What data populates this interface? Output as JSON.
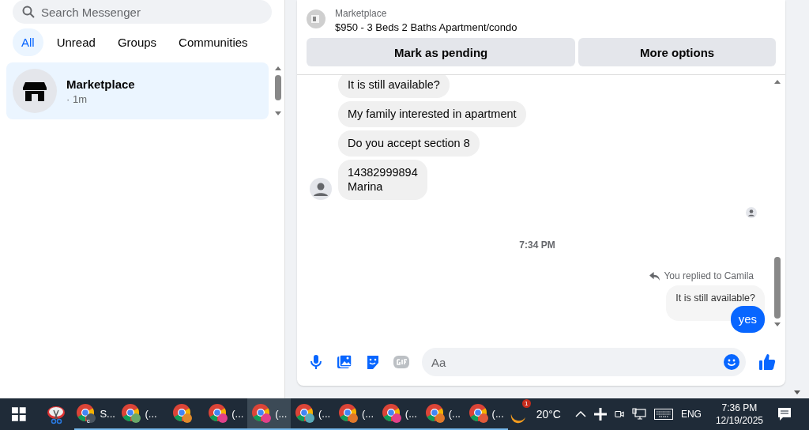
{
  "sidebar": {
    "search": {
      "placeholder": "Search Messenger"
    },
    "filters": [
      {
        "label": "All",
        "selected": true
      },
      {
        "label": "Unread",
        "selected": false
      },
      {
        "label": "Groups",
        "selected": false
      },
      {
        "label": "Communities",
        "selected": false
      }
    ],
    "conversations": [
      {
        "name": "Marketplace",
        "time": "· 1m",
        "selected": true
      }
    ]
  },
  "chat": {
    "listing": {
      "category": "Marketplace",
      "title": "$950 - 3 Beds 2 Baths Apartment/condo"
    },
    "actions": [
      "Mark as pending",
      "More options"
    ],
    "incoming": [
      "It is still available?",
      "My family  interested in apartment",
      "Do you accept section 8",
      "14382999894\nMarina"
    ],
    "timestamp": "7:34 PM",
    "reply": {
      "label": "You replied to Camila",
      "quoted": "It is still available?",
      "text": "yes"
    },
    "composer": {
      "placeholder": "Aa"
    }
  },
  "taskbar": {
    "apps": [
      {
        "label": "S...",
        "color": "#4a5560",
        "selected": false,
        "badge": "c"
      },
      {
        "label": "(...",
        "color": "#6aa86a",
        "selected": false
      },
      {
        "color": "#e08a2a",
        "selected": false
      },
      {
        "label": "(...",
        "color": "#e0408a",
        "selected": false
      },
      {
        "label": "(...",
        "color": "#e0408a",
        "selected": true
      },
      {
        "label": "(...",
        "color": "#5aaab8",
        "selected": false
      },
      {
        "label": "(...",
        "color": "#e0782a",
        "selected": false
      },
      {
        "label": "(...",
        "color": "#e0408a",
        "selected": false
      },
      {
        "label": "(...",
        "color": "#e0782a",
        "selected": false
      },
      {
        "label": "(...",
        "color": "#e05a3a",
        "selected": false
      }
    ],
    "weather": {
      "badge": "1",
      "temp": "20°C"
    },
    "language": "ENG",
    "time": "7:36 PM",
    "date": "12/19/2025"
  }
}
